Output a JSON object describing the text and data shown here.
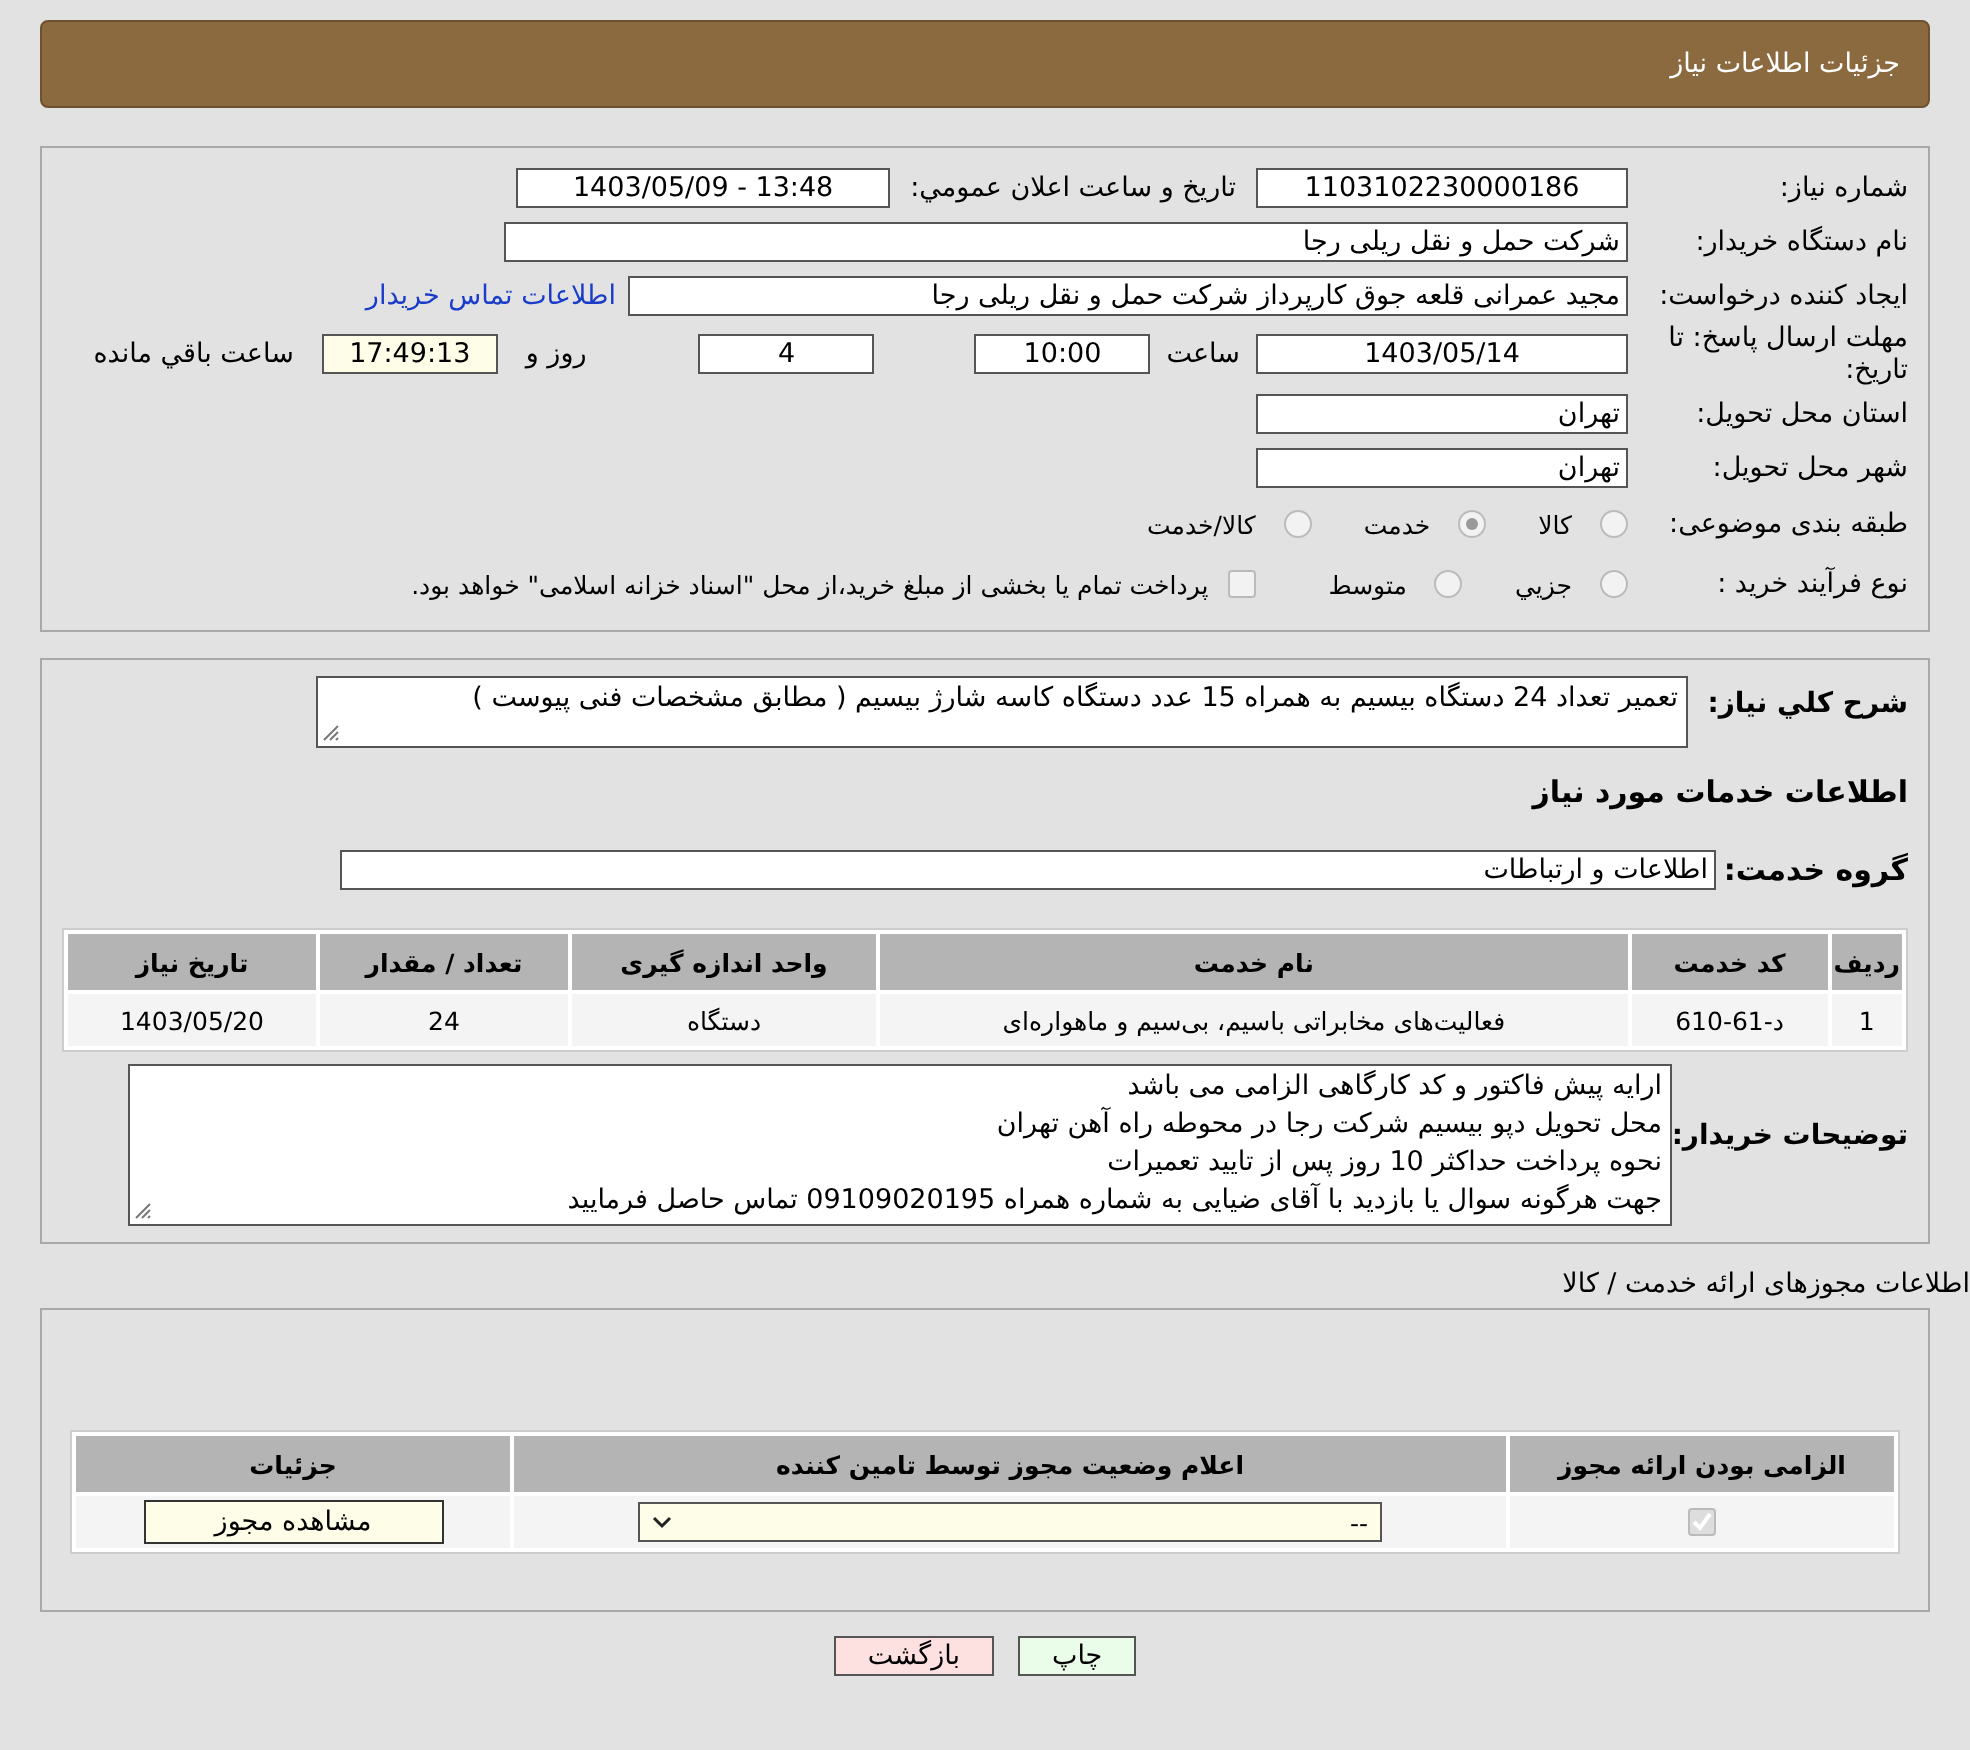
{
  "header": {
    "title": "جزئیات اطلاعات نیاز"
  },
  "need_number": {
    "label": "شماره نیاز:",
    "value": "1103102230000186"
  },
  "announce": {
    "label": "تاریخ و ساعت اعلان عمومي:",
    "value": "1403/05/09 - 13:48"
  },
  "buyer": {
    "label": "نام دستگاه خریدار:",
    "value": "شرکت حمل و نقل ریلی رجا"
  },
  "creator": {
    "label": "ایجاد کننده درخواست:",
    "value": "مجید عمرانی قلعه جوق کارپرداز شرکت حمل و نقل ریلی رجا",
    "link": "اطلاعات تماس خریدار"
  },
  "deadline": {
    "label": "مهلت ارسال پاسخ: تا تاریخ:",
    "date": "1403/05/14",
    "time_label": "ساعت",
    "time": "10:00",
    "days": "4",
    "days_label": "روز و",
    "remaining": "17:49:13",
    "remaining_label": "ساعت باقي مانده"
  },
  "province": {
    "label": "استان محل تحویل:",
    "value": "تهران"
  },
  "city": {
    "label": "شهر محل تحویل:",
    "value": "تهران"
  },
  "category": {
    "label": "طبقه بندی موضوعی:",
    "options": [
      {
        "label": "کالا",
        "selected": false
      },
      {
        "label": "خدمت",
        "selected": true
      },
      {
        "label": "کالا/خدمت",
        "selected": false
      }
    ]
  },
  "process": {
    "label": "نوع فرآیند خرید :",
    "options": [
      {
        "label": "جزيي",
        "selected": false
      },
      {
        "label": "متوسط",
        "selected": false
      }
    ],
    "payment": {
      "label": "پرداخت تمام یا بخشی از مبلغ خرید،از محل \"اسناد خزانه اسلامی\" خواهد بود.",
      "checked": false
    }
  },
  "description": {
    "label": "شرح کلي نیاز:",
    "value": "تعمیر تعداد 24 دستگاه بیسیم به همراه 15 عدد دستگاه کاسه شارژ بیسیم ( مطابق مشخصات فنی پیوست )"
  },
  "services_title": "اطلاعات خدمات مورد نیاز",
  "service_group": {
    "label": "گروه خدمت:",
    "value": "اطلاعات و ارتباطات"
  },
  "table": {
    "columns": [
      "ردیف",
      "کد خدمت",
      "نام خدمت",
      "واحد اندازه گیری",
      "تعداد / مقدار",
      "تاریخ نیاز"
    ],
    "rows": [
      [
        "1",
        "د-61-610",
        "فعالیت‌های مخابراتی باسیم، بی‌سیم و ماهواره‌ای",
        "دستگاه",
        "24",
        "1403/05/20"
      ]
    ]
  },
  "buyer_notes": {
    "label": "توضیحات خریدار:",
    "lines": [
      "ارایه پیش فاکتور و کد کارگاهی الزامی می باشد",
      "محل تحویل دپو بیسیم شرکت رجا در محوطه راه آهن تهران",
      "نحوه پرداخت حداکثر 10 روز پس از تایید تعمیرات",
      "جهت هرگونه سوال یا بازدید با آقای ضیایی به شماره همراه 09109020195 تماس حاصل فرمایید"
    ]
  },
  "licenses": {
    "title": "اطلاعات مجوزهای ارائه خدمت / کالا",
    "columns": [
      "الزامی بودن ارائه مجوز",
      "اعلام وضعیت مجوز توسط تامین کننده",
      "جزئیات"
    ],
    "rows": [
      {
        "required": true,
        "status": "--",
        "action": "مشاهده مجوز"
      }
    ]
  },
  "buttons": [
    {
      "label": "چاپ",
      "kind": "print"
    },
    {
      "label": "بازگشت",
      "kind": "back"
    }
  ]
}
